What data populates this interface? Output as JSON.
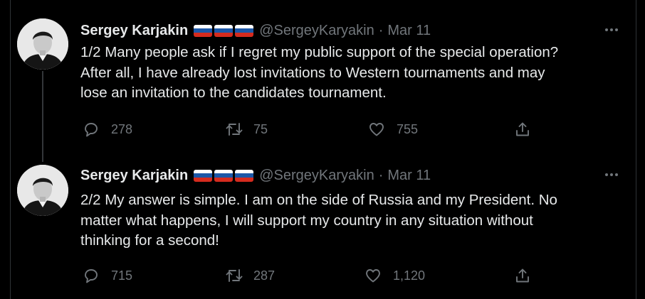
{
  "colors": {
    "background": "#000000",
    "text": "#e7e9ea",
    "muted": "#71767b",
    "thread": "#333639"
  },
  "tweets": [
    {
      "name": "Sergey Karjakin",
      "flags": [
        "russia-flag",
        "russia-flag",
        "russia-flag"
      ],
      "handle": "@SergeyKaryakin",
      "separator": "·",
      "date": "Mar 11",
      "text_lines": [
        "1/2 Many people ask if I regret my public support of the special operation?",
        "After all, I have already lost invitations to Western tournaments and may",
        "lose an invitation to the candidates tournament."
      ],
      "replies": "278",
      "retweets": "75",
      "likes": "755"
    },
    {
      "name": "Sergey Karjakin",
      "flags": [
        "russia-flag",
        "russia-flag",
        "russia-flag"
      ],
      "handle": "@SergeyKaryakin",
      "separator": "·",
      "date": "Mar 11",
      "text_lines": [
        "2/2 My answer is simple. I am on the side of Russia and my President. No",
        "matter what happens, I will support my country in any situation without",
        "thinking for a second!"
      ],
      "replies": "715",
      "retweets": "287",
      "likes": "1,120"
    }
  ]
}
